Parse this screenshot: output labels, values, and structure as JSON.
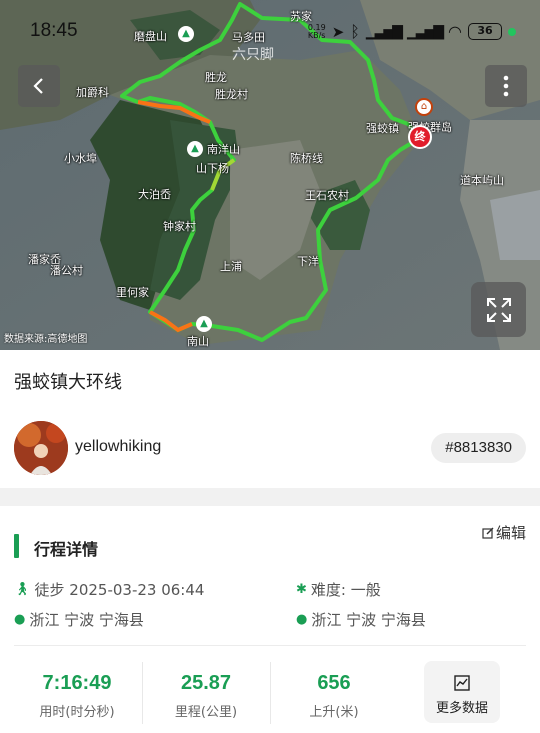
{
  "status_bar": {
    "time": "18:45",
    "network_speed": "0.19\nKB/s",
    "battery": "36"
  },
  "map": {
    "watermark": "六只脚",
    "source_note": "数据来源:高德地图",
    "end_marker": "终",
    "labels": {
      "hill_mopan": "磨盘山",
      "maduotian": "马多田",
      "sujia": "苏家",
      "jiajiao": "加爵科",
      "shenglong": "胜龙",
      "shenglong_village": "胜龙村",
      "qiangjiao": "强蛟镇",
      "qunfang_island": "强蛟群岛",
      "xiaoshuibu": "小水埠",
      "nanjie_hill": "南洋山",
      "shanxiang": "山下杨",
      "chenfu": "陈桥线",
      "wangshi": "王石农村",
      "dabo": "大泊岙",
      "zhongxia": "钟家村",
      "shangpu": "上浦",
      "daoben": "道本屿山",
      "panjiajia": "潘家岙",
      "pangongcun": "潘公村",
      "xiayang": "下洋",
      "lihejia": "里何家",
      "nanshan": "南山"
    }
  },
  "route": {
    "title": "强蛟镇大环线",
    "author": "yellowhiking",
    "id_badge": "#8813830"
  },
  "details": {
    "section_title": "行程详情",
    "edit_label": "编辑",
    "activity": "徒步 2025-03-23 06:44",
    "difficulty": "难度: 一般",
    "start_location": "浙江 宁波 宁海县",
    "end_location": "浙江 宁波 宁海县"
  },
  "stats": [
    {
      "value": "7:16:49",
      "label": "用时(时分秒)"
    },
    {
      "value": "25.87",
      "label": "里程(公里)"
    },
    {
      "value": "656",
      "label": "上升(米)"
    }
  ],
  "more_data_label": "更多数据",
  "colors": {
    "accent_green": "#1a9e54",
    "route_green": "#3dd13d",
    "route_orange": "#f97316",
    "end_red": "#e11d2b"
  }
}
